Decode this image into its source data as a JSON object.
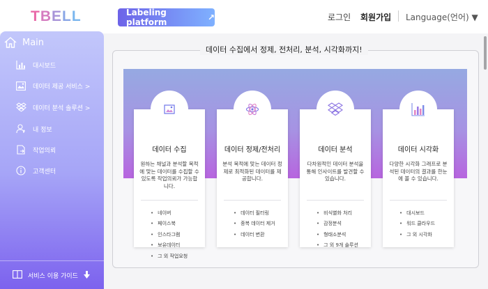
{
  "header": {
    "logo_letters": [
      "T",
      "B",
      "E",
      "L",
      "L"
    ],
    "labeling_button": "Labeling platform",
    "labeling_arrow": "↗",
    "login": "로그인",
    "signup": "회원가입",
    "language": "Language(언어) ▼"
  },
  "sidebar": {
    "main_label": "Main",
    "items": [
      {
        "label": "대시보드",
        "icon": "bar-chart-icon"
      },
      {
        "label": "데이터 제공 서비스 >",
        "icon": "image-icon"
      },
      {
        "label": "데이터 분석 솔루션 >",
        "icon": "dropbox-icon"
      },
      {
        "label": "내 정보",
        "icon": "user-icon"
      },
      {
        "label": "작업의뢰",
        "icon": "document-icon"
      },
      {
        "label": "고객센터",
        "icon": "info-icon"
      }
    ],
    "footer_label": "서비스 이용 가이드",
    "footer_arrow": "🡇"
  },
  "main": {
    "panel_title": "데이터 수집에서 정제, 전처리, 분석, 시각화까지!",
    "cards": [
      {
        "title": "데이터 수집",
        "icon": "image-icon",
        "desc": "원하는 채널과 분석할 목적에 맞는 데이터를 수집할 수 있도록 작업의뢰가 가능합니다.",
        "list": [
          "네이버",
          "페이스북",
          "인스타그램",
          "보유데이터",
          "그 외 작업요청"
        ]
      },
      {
        "title": "데이터 정제/전처리",
        "icon": "atom-icon",
        "desc": "분석 목적에 맞는 데이터 정제로 최적화된 데이터를 제공합니다.",
        "list": [
          "데이터 필터링",
          "중복 데이터 제거",
          "데이터 변환"
        ]
      },
      {
        "title": "데이터 분석",
        "icon": "dropbox-icon",
        "desc": "다차원적인 데이터 분석을 통해 인사이트를 발견할 수 있습니다.",
        "list": [
          "비식별화 처리",
          "감정분석",
          "형태소분석",
          "그 외 9개 솔루션"
        ]
      },
      {
        "title": "데이터 시각화",
        "icon": "bar-chart-icon",
        "desc": "다양한 시각화 그래프로 분석된 데이터의 결과를 한눈에 볼 수 있습니다.",
        "list": [
          "대시보드",
          "워드 클라우드",
          "그 외 시각화"
        ]
      }
    ]
  },
  "colors": {
    "accent": "#7c62ee",
    "sidebar_top": "#c2c7fb",
    "banner_bottom": "#b765df"
  }
}
